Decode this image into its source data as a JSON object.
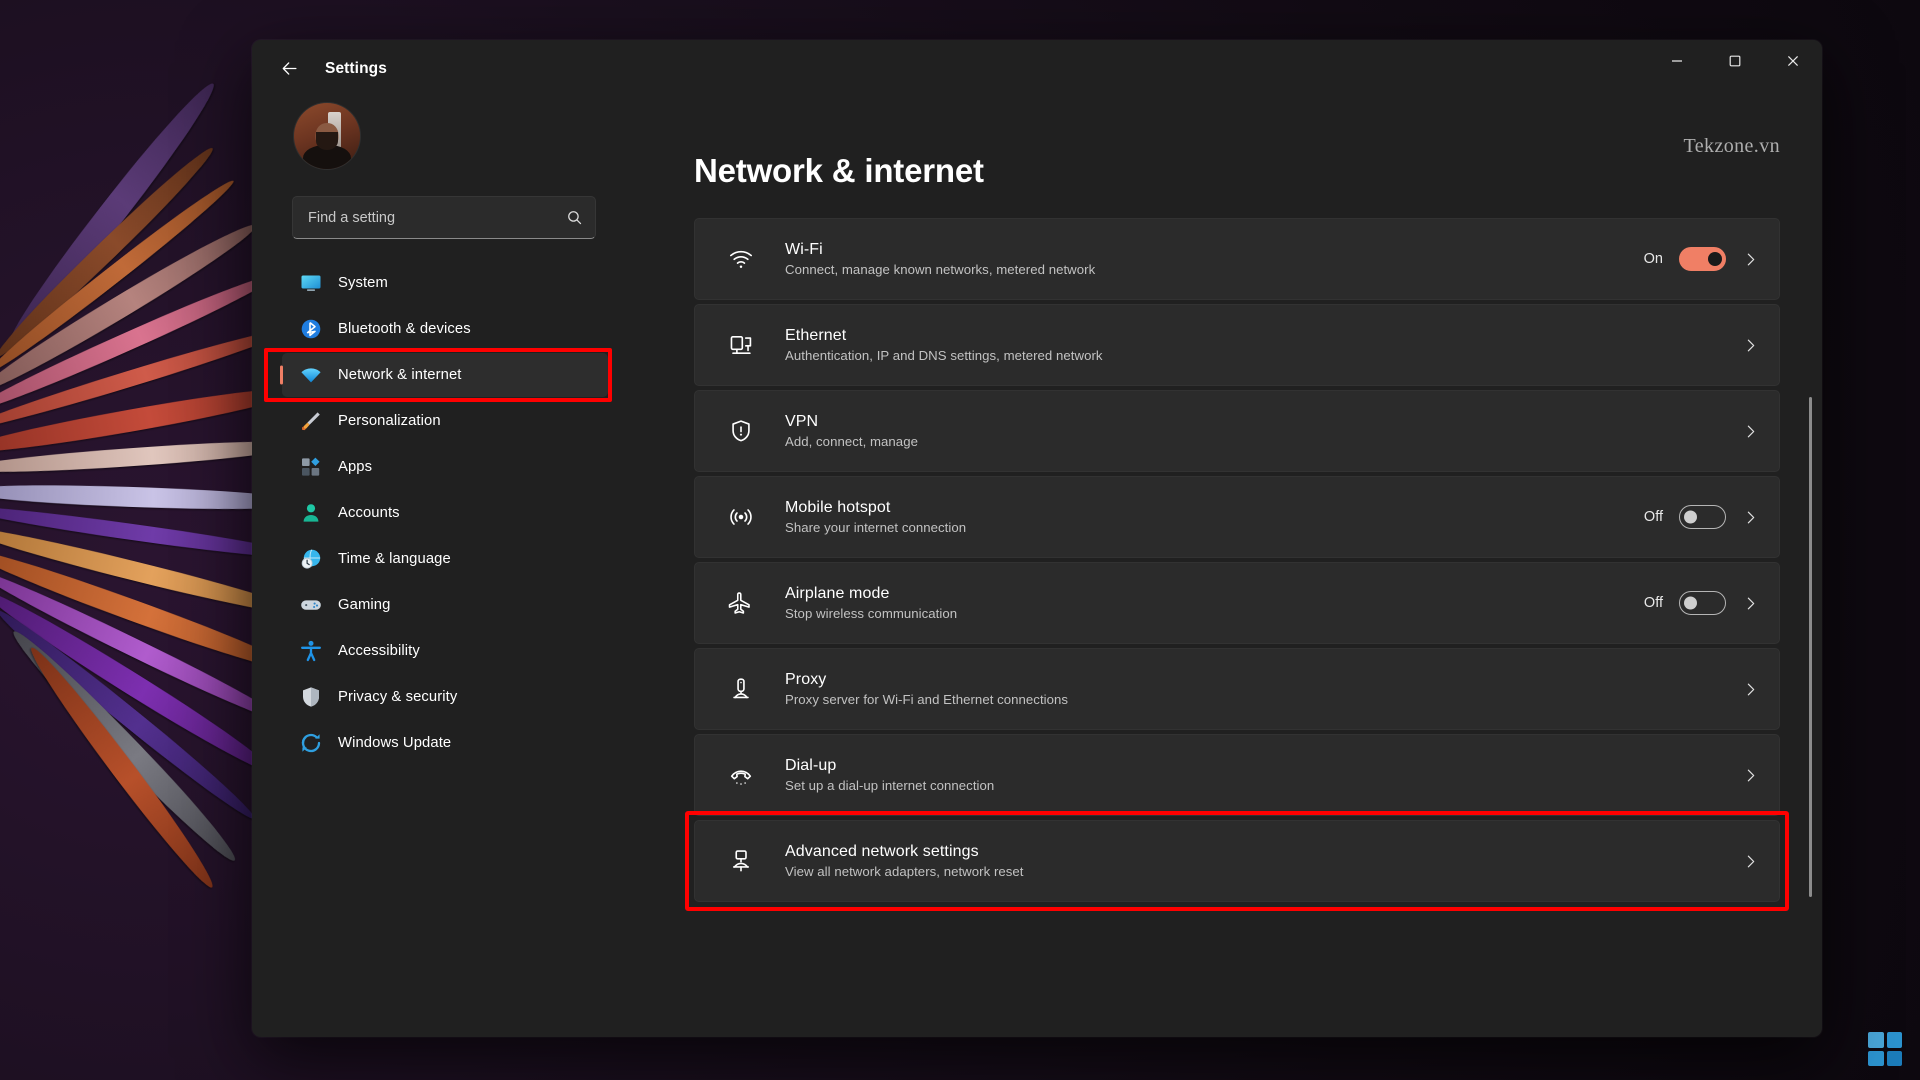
{
  "colors": {
    "accent": "#f07f65",
    "annotation": "#ff0000",
    "window_bg": "#202020",
    "card_bg": "#2b2b2b"
  },
  "titlebar": {
    "back_label": "Back",
    "app_title": "Settings",
    "minimize_label": "Minimize",
    "maximize_label": "Maximize",
    "close_label": "Close"
  },
  "watermark": "Tekzone.vn",
  "sidebar": {
    "search": {
      "placeholder": "Find a setting",
      "value": ""
    },
    "items": [
      {
        "label": "System",
        "icon": "monitor-icon",
        "selected": false
      },
      {
        "label": "Bluetooth & devices",
        "icon": "bluetooth-icon",
        "selected": false
      },
      {
        "label": "Network & internet",
        "icon": "wifi-icon",
        "selected": true
      },
      {
        "label": "Personalization",
        "icon": "paintbrush-icon",
        "selected": false
      },
      {
        "label": "Apps",
        "icon": "apps-icon",
        "selected": false
      },
      {
        "label": "Accounts",
        "icon": "person-icon",
        "selected": false
      },
      {
        "label": "Time & language",
        "icon": "clock-globe-icon",
        "selected": false
      },
      {
        "label": "Gaming",
        "icon": "gamepad-icon",
        "selected": false
      },
      {
        "label": "Accessibility",
        "icon": "accessibility-icon",
        "selected": false
      },
      {
        "label": "Privacy & security",
        "icon": "shield-icon",
        "selected": false
      },
      {
        "label": "Windows Update",
        "icon": "update-icon",
        "selected": false
      }
    ]
  },
  "main": {
    "page_title": "Network & internet",
    "cards": [
      {
        "title": "Wi-Fi",
        "subtitle": "Connect, manage known networks, metered network",
        "icon": "wifi-icon",
        "state_label": "On",
        "toggle": "on",
        "highlighted": false
      },
      {
        "title": "Ethernet",
        "subtitle": "Authentication, IP and DNS settings, metered network",
        "icon": "ethernet-icon",
        "state_label": "",
        "toggle": "none",
        "highlighted": false
      },
      {
        "title": "VPN",
        "subtitle": "Add, connect, manage",
        "icon": "vpn-shield-icon",
        "state_label": "",
        "toggle": "none",
        "highlighted": false
      },
      {
        "title": "Mobile hotspot",
        "subtitle": "Share your internet connection",
        "icon": "hotspot-icon",
        "state_label": "Off",
        "toggle": "off",
        "highlighted": false
      },
      {
        "title": "Airplane mode",
        "subtitle": "Stop wireless communication",
        "icon": "airplane-icon",
        "state_label": "Off",
        "toggle": "off",
        "highlighted": false
      },
      {
        "title": "Proxy",
        "subtitle": "Proxy server for Wi-Fi and Ethernet connections",
        "icon": "proxy-server-icon",
        "state_label": "",
        "toggle": "none",
        "highlighted": false
      },
      {
        "title": "Dial-up",
        "subtitle": "Set up a dial-up internet connection",
        "icon": "dialup-phone-icon",
        "state_label": "",
        "toggle": "none",
        "highlighted": false
      },
      {
        "title": "Advanced network settings",
        "subtitle": "View all network adapters, network reset",
        "icon": "advanced-network-icon",
        "state_label": "",
        "toggle": "none",
        "highlighted": true
      }
    ]
  }
}
